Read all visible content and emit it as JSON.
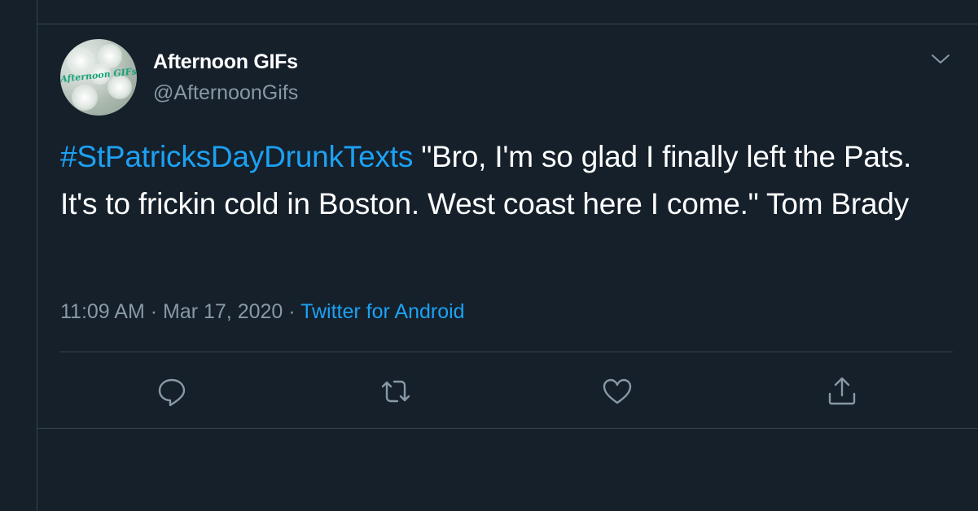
{
  "tweet": {
    "display_name": "Afternoon GIFs",
    "handle": "@AfternoonGifs",
    "avatar_text": "Afternoon GIFs",
    "hashtag": "#StPatricksDayDrunkTexts",
    "body": " \"Bro, I'm so glad I finally left the Pats. It's to frickin cold in Boston. West coast here I come.\" Tom Brady",
    "time": "11:09 AM",
    "separator": " · ",
    "date": "Mar 17, 2020",
    "source": "Twitter for Android"
  },
  "icons": {
    "menu": "chevron-down-icon",
    "reply": "reply-icon",
    "retweet": "retweet-icon",
    "like": "heart-icon",
    "share": "share-icon"
  },
  "colors": {
    "background": "#15202b",
    "link": "#1da1f2",
    "secondary_text": "#8899a6",
    "border": "#38444d"
  }
}
